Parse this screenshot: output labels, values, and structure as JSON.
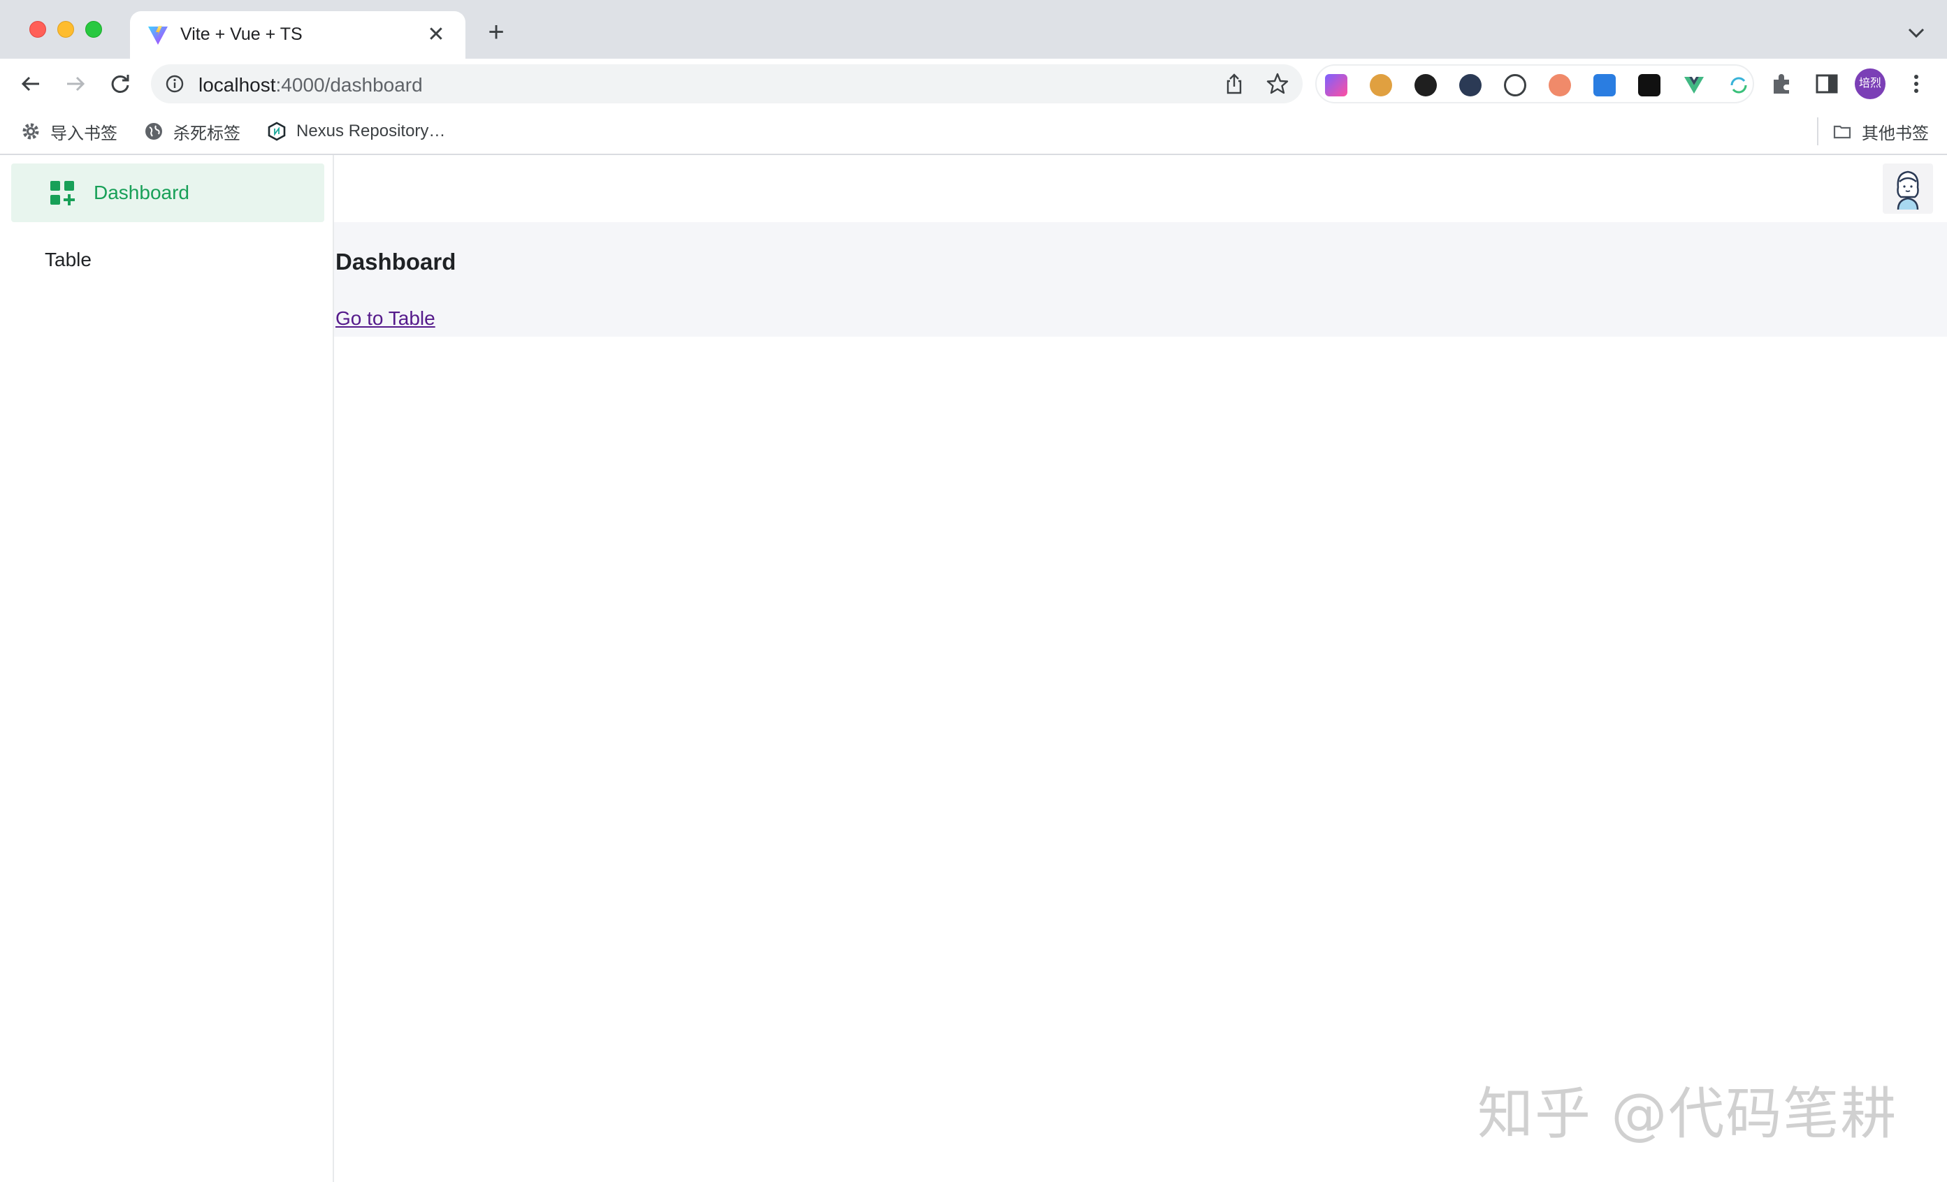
{
  "browser": {
    "tab": {
      "title": "Vite + Vue + TS",
      "close_glyph": "✕",
      "favicon": "vite-icon"
    },
    "new_tab_glyph": "+",
    "address": {
      "host": "localhost",
      "rest": ":4000/dashboard"
    },
    "profile_label": "培烈",
    "bookmarks": [
      {
        "label": "导入书签",
        "icon": "gear-icon"
      },
      {
        "label": "杀死标签",
        "icon": "globe-icon"
      },
      {
        "label": "Nexus Repository…",
        "icon": "nexus-icon"
      }
    ],
    "other_bookmarks": {
      "label": "其他书签",
      "icon": "folder-icon"
    }
  },
  "sidebar": {
    "items": [
      {
        "label": "Dashboard",
        "icon": "dashboard-icon",
        "active": true
      },
      {
        "label": "Table",
        "active": false
      }
    ]
  },
  "main": {
    "title": "Dashboard",
    "link": "Go to Table"
  },
  "watermark": "知乎 @代码笔耕",
  "colors": {
    "accent": "#18a058",
    "active_bg": "#e8f5ee",
    "content_bg": "#f5f6f9",
    "link": "#551a8b",
    "profile": "#7b3fb6"
  }
}
